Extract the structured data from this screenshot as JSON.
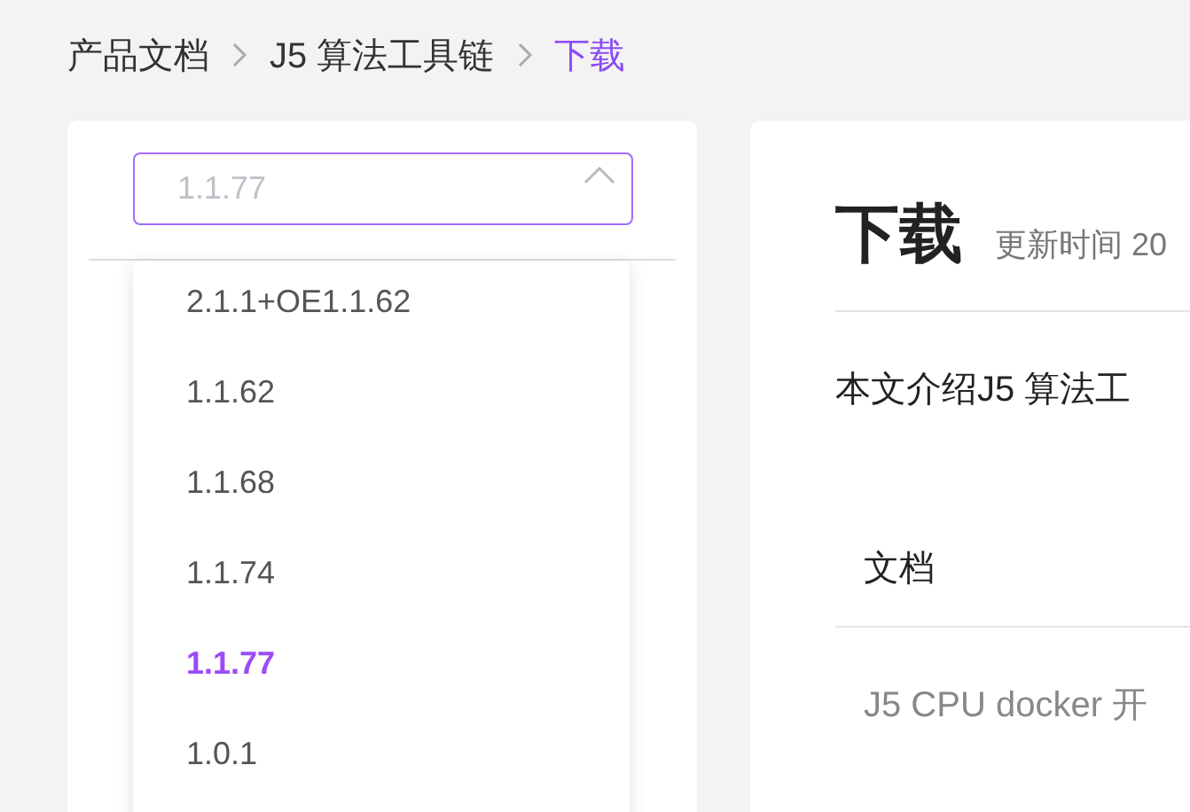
{
  "breadcrumb": [
    {
      "label": "产品文档",
      "selected": false
    },
    {
      "label": "J5 算法工具链",
      "selected": false
    },
    {
      "label": "下载",
      "selected": true
    }
  ],
  "version_select": {
    "placeholder": "1.1.77",
    "expanded": true,
    "options": [
      {
        "label": "2.1.1+OE1.1.62",
        "selected": false
      },
      {
        "label": "1.1.62",
        "selected": false
      },
      {
        "label": "1.1.68",
        "selected": false
      },
      {
        "label": "1.1.74",
        "selected": false
      },
      {
        "label": "1.1.77",
        "selected": true
      },
      {
        "label": "1.0.1",
        "selected": false
      }
    ]
  },
  "article": {
    "title": "下载",
    "updated": "更新时间 20",
    "intro": "本文介绍J5 算法工",
    "table": {
      "columns": [
        "文档"
      ],
      "rows": [
        [
          "J5 CPU docker 开"
        ]
      ]
    }
  }
}
